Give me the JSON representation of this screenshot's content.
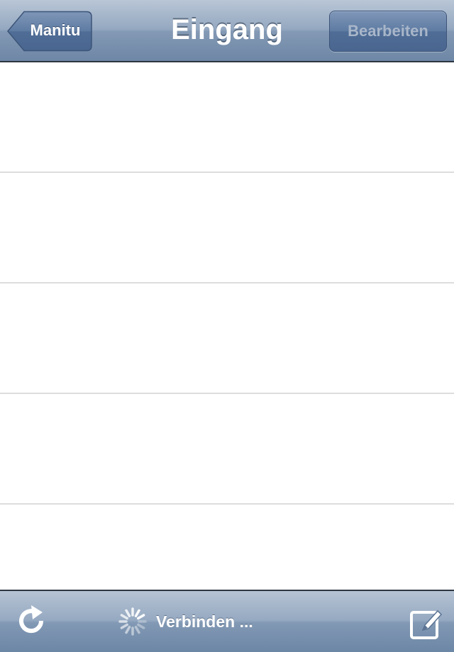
{
  "navbar": {
    "title": "Eingang",
    "back_label": "Manitu",
    "edit_label": "Bearbeiten"
  },
  "list": {
    "rows": [
      "",
      "",
      "",
      "",
      ""
    ]
  },
  "toolbar": {
    "status_text": "Verbinden ...",
    "refresh_icon": "refresh-icon",
    "spinner_icon": "activity-spinner-icon",
    "compose_icon": "compose-icon"
  },
  "colors": {
    "bar_top": "#b9c6d6",
    "bar_bottom": "#6e87a6",
    "button_blue": "#4f6d96",
    "separator": "#dddddd"
  }
}
